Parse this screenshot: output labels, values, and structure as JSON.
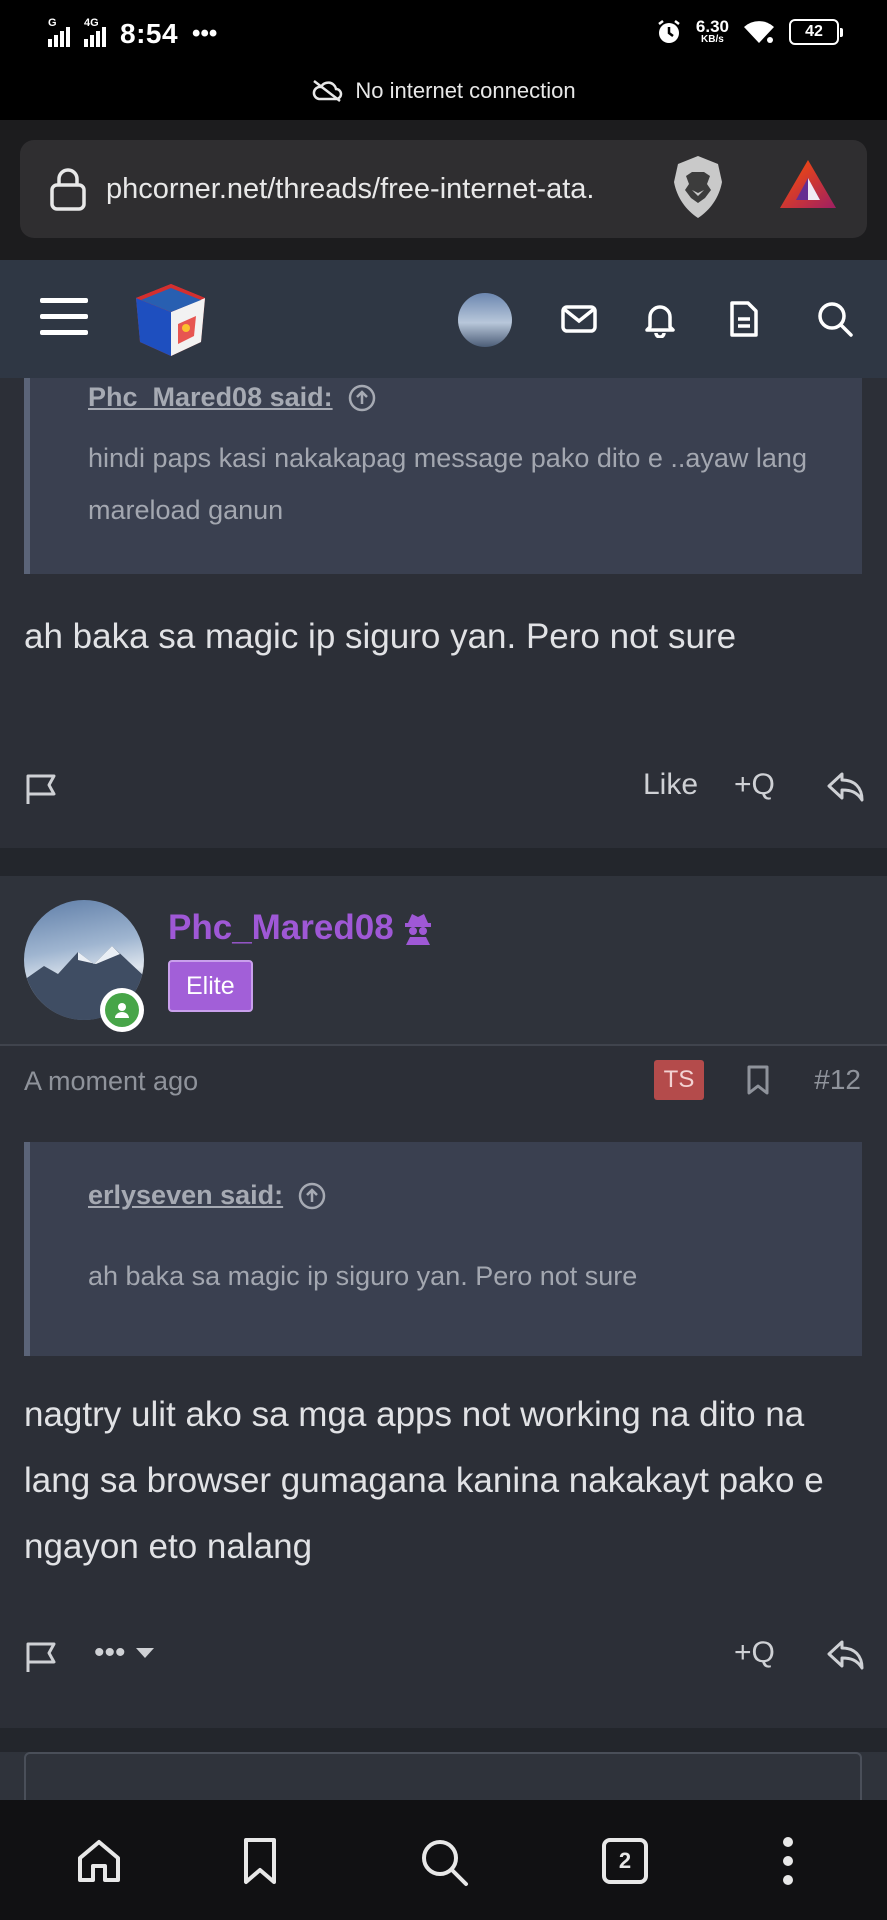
{
  "status_bar": {
    "network_label": "G",
    "network_label2": "4G",
    "time": "8:54",
    "more": "•••",
    "speed_value": "6.30",
    "speed_unit": "KB/s",
    "battery": "42",
    "no_internet": "No internet connection"
  },
  "browser": {
    "url": "phcorner.net/threads/free-internet-ata.",
    "tab_count": "2"
  },
  "post_prev": {
    "quote_author": "Phc_Mared08 said:",
    "quote_text": "hindi paps kasi nakakapag message pako dito e ..ayaw lang mareload ganun",
    "body": "ah baka sa magic ip siguro yan. Pero not sure",
    "like_label": "Like",
    "quote_label": "+Q"
  },
  "post_12": {
    "username": "Phc_Mared08",
    "badge": "Elite",
    "time": "A moment ago",
    "ts_label": "TS",
    "post_number": "#12",
    "quote_author": "erlyseven said:",
    "quote_text": "ah baka sa magic ip siguro yan. Pero not sure",
    "body": "nagtry ulit ako sa mga apps not working na dito na lang sa browser gumagana kanina nakakayt pako e ngayon eto nalang",
    "more_label": "•••",
    "quote_label": "+Q"
  },
  "colors": {
    "accent_purple": "#9f58d6",
    "ts_red": "#b44b4b",
    "online_green": "#47a548",
    "header_bg": "#2f3744"
  }
}
